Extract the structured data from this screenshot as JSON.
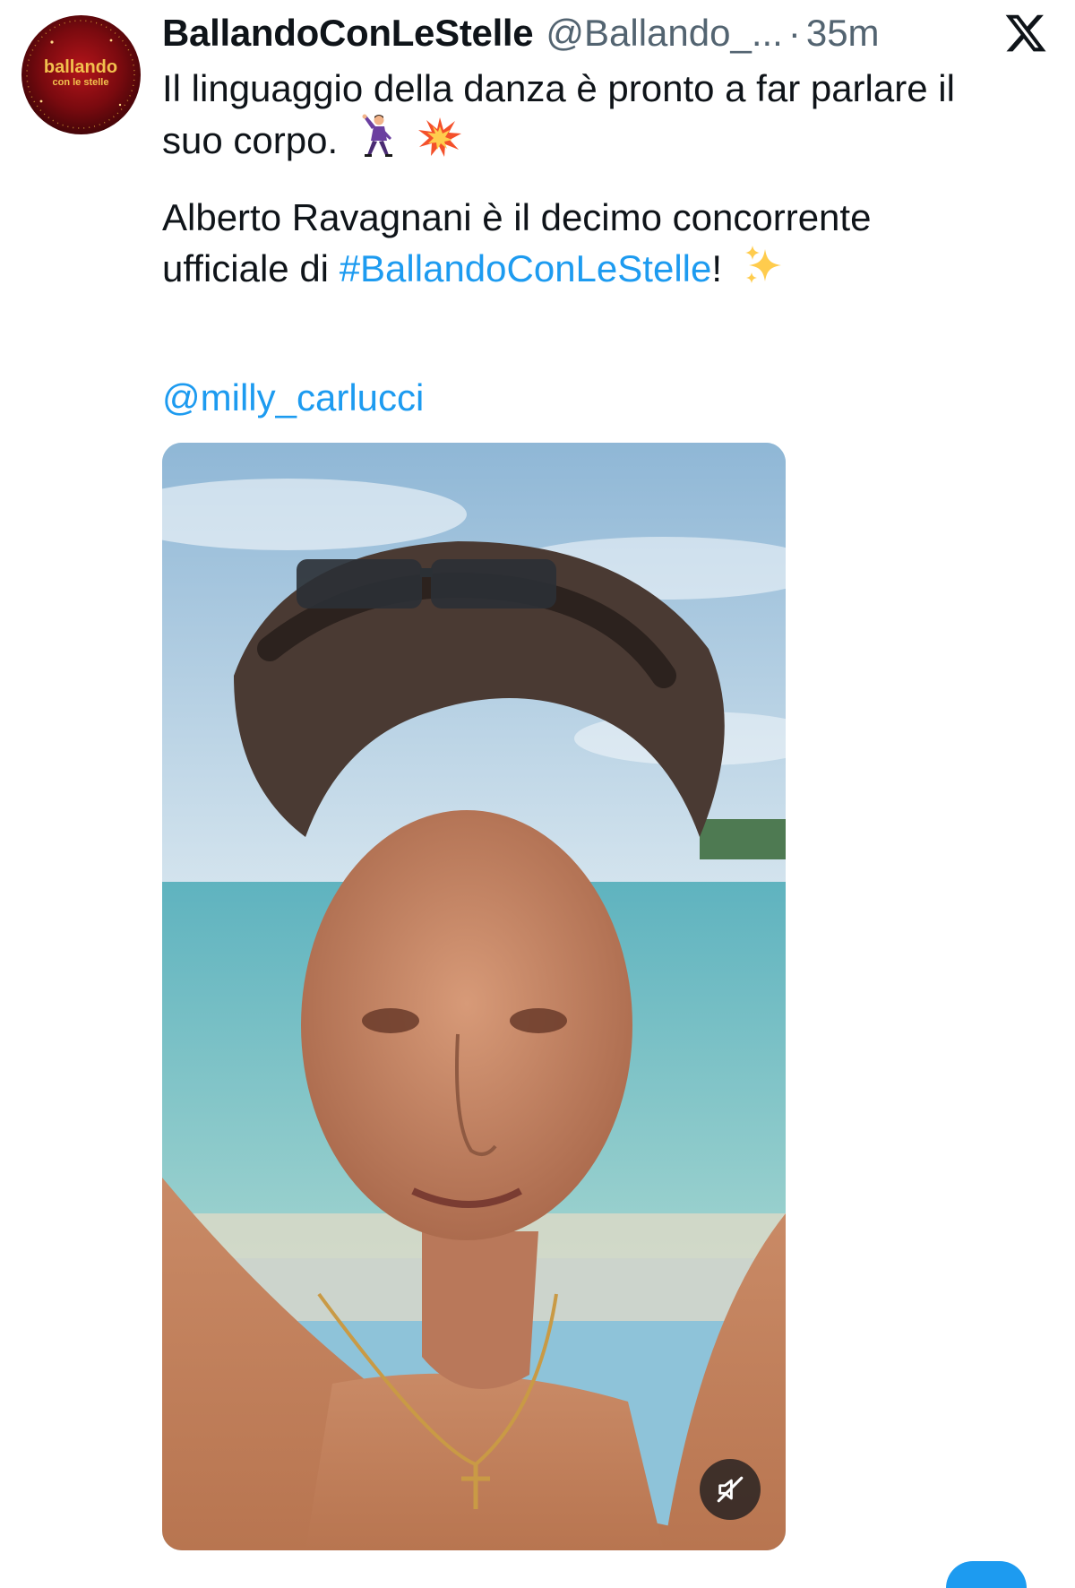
{
  "tweet": {
    "author": {
      "display_name": "BallandoConLeStelle",
      "handle": "@Ballando_...",
      "avatar_text_top": "ballando",
      "avatar_text_bottom": "con le stelle"
    },
    "separator": "·",
    "timestamp": "35m",
    "text": {
      "line1": "Il linguaggio della danza è pronto a far parlare il",
      "line2": "suo corpo.",
      "line3": "Alberto Ravagnani è il decimo concorrente",
      "line4_prefix": "ufficiale di ",
      "hashtag": "#BallandoConLeStelle",
      "line4_suffix": "!",
      "mention": "@milly_carlucci"
    },
    "emojis": [
      "man-dancing-icon",
      "collision-icon",
      "sparkles-icon"
    ],
    "media": {
      "type": "video",
      "muted": true
    }
  },
  "colors": {
    "link": "#1d9bf0",
    "text": "#0f1419",
    "secondary": "#536471"
  }
}
